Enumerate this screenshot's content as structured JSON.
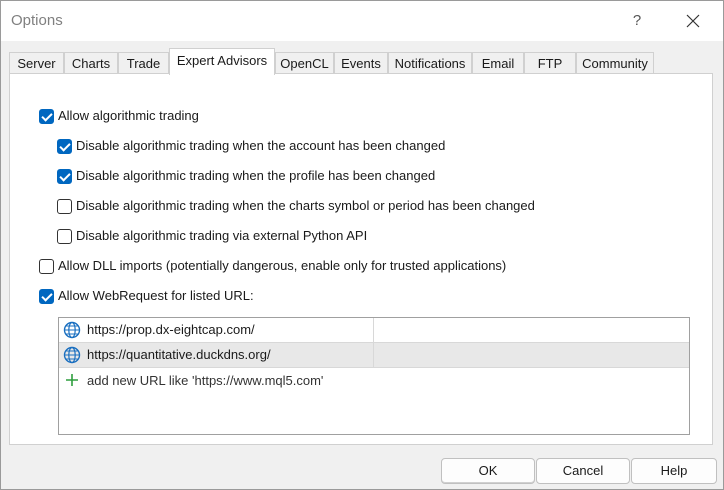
{
  "window": {
    "title": "Options",
    "help_label": "?",
    "close_icon": "close-icon"
  },
  "tabs": [
    {
      "label": "Server"
    },
    {
      "label": "Charts"
    },
    {
      "label": "Trade"
    },
    {
      "label": "Expert Advisors",
      "active": true
    },
    {
      "label": "OpenCL"
    },
    {
      "label": "Events"
    },
    {
      "label": "Notifications"
    },
    {
      "label": "Email"
    },
    {
      "label": "FTP"
    },
    {
      "label": "Community"
    }
  ],
  "options": {
    "allow_algo": {
      "label": "Allow algorithmic trading",
      "checked": true
    },
    "disable_account": {
      "label": "Disable algorithmic trading when the account has been changed",
      "checked": true
    },
    "disable_profile": {
      "label": "Disable algorithmic trading when the profile has been changed",
      "checked": true
    },
    "disable_symbol": {
      "label": "Disable algorithmic trading when the charts symbol or period has been changed",
      "checked": false
    },
    "disable_python": {
      "label": "Disable algorithmic trading via external Python API",
      "checked": false
    },
    "allow_dll": {
      "label": "Allow DLL imports (potentially dangerous, enable only for trusted applications)",
      "checked": false
    },
    "allow_webrequest": {
      "label": "Allow WebRequest for listed URL:",
      "checked": true
    }
  },
  "url_list": {
    "urls": [
      {
        "url": "https://prop.dx-eightcap.com/",
        "icon": "globe-icon",
        "selected": false
      },
      {
        "url": "https://quantitative.duckdns.org/",
        "icon": "globe-icon",
        "selected": true
      }
    ],
    "add_placeholder": "add new URL like 'https://www.mql5.com'",
    "add_icon": "plus-icon"
  },
  "buttons": {
    "ok": "OK",
    "cancel": "Cancel",
    "help": "Help"
  },
  "colors": {
    "accent": "#0067c0",
    "plus": "#2e9e3e",
    "globe": "#1a6fc0"
  }
}
